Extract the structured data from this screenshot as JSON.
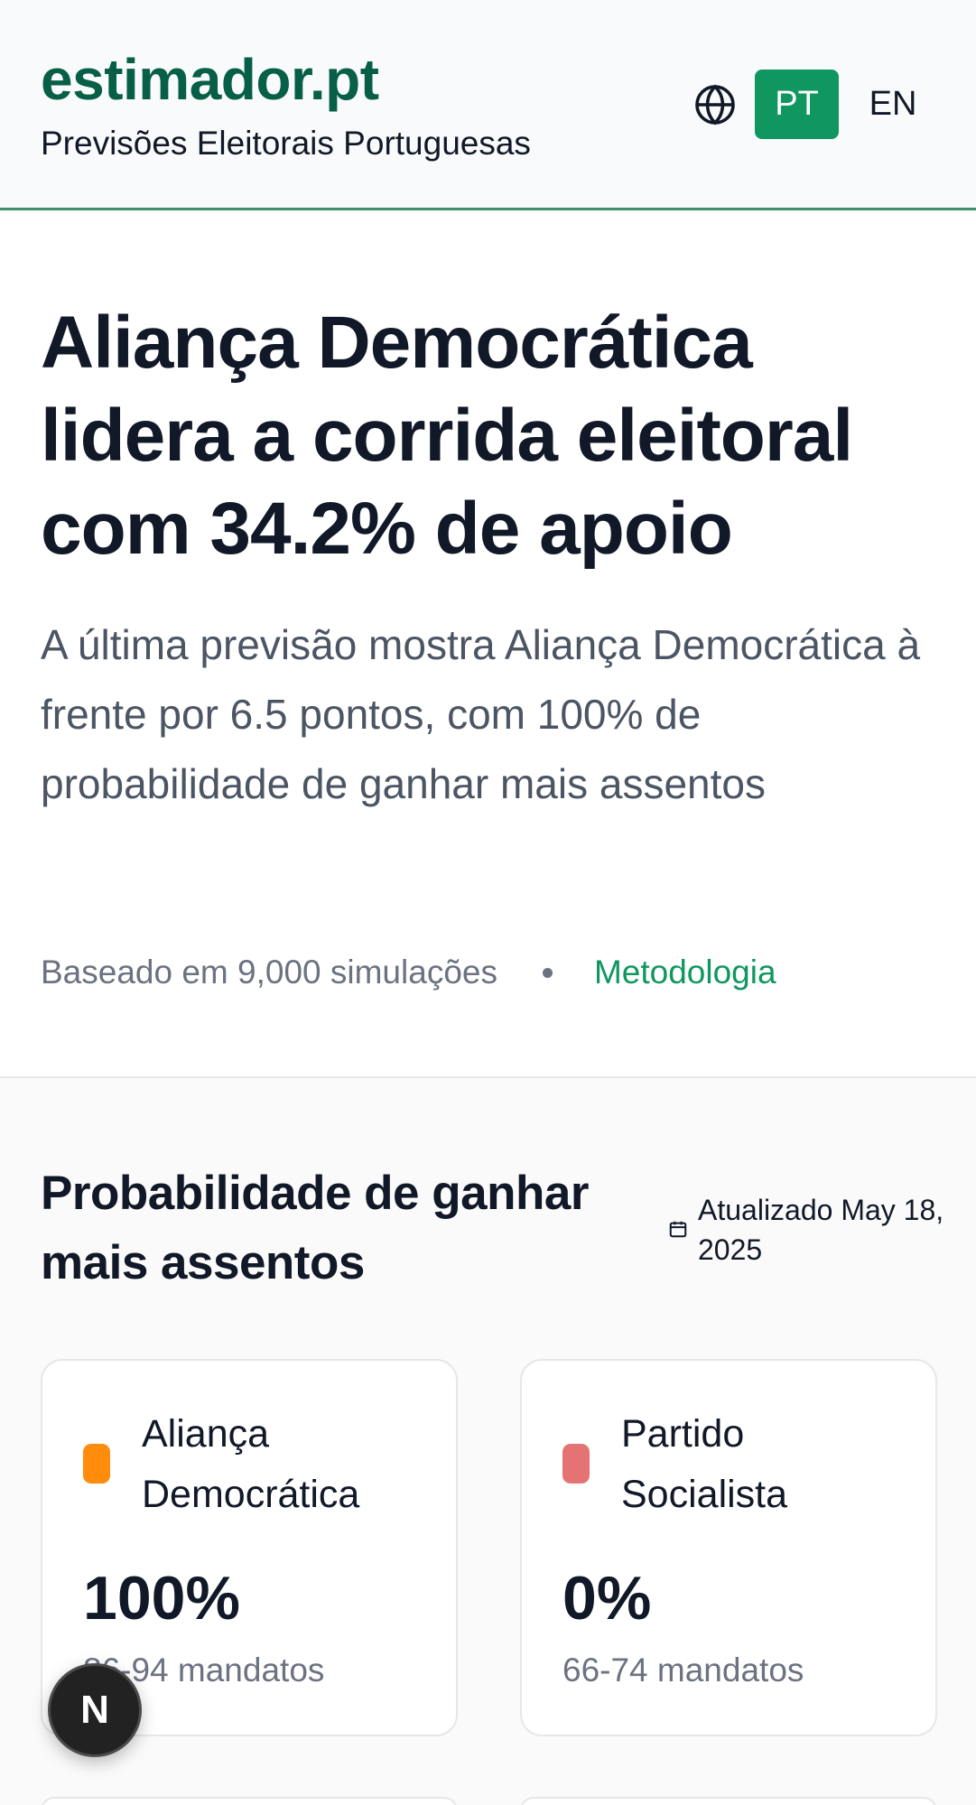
{
  "header": {
    "brand": "estimador.pt",
    "tagline": "Previsões Eleitorais Portuguesas",
    "language_icon": "globe-icon",
    "languages": [
      "PT",
      "EN"
    ],
    "active_language": "PT"
  },
  "hero": {
    "headline": "Aliança Democrática lidera a corrida eleitoral com 34.2% de apoio",
    "lead": "A última previsão mostra Aliança Democrática à frente por 6.5 pontos, com 100% de probabilidade de ganhar mais assentos",
    "simulations": "Baseado em 9,000 simulações",
    "methodology_link": "Metodologia"
  },
  "probability_section": {
    "title": "Probabilidade de ganhar mais assentos",
    "updated_icon": "calendar-icon",
    "updated": "Atualizado May 18, 2025",
    "cards": [
      {
        "party": "Aliança Democrática",
        "color": "#ff8c0a",
        "probability": "100%",
        "seats": "86-94 mandatos"
      },
      {
        "party": "Partido Socialista",
        "color": "#e57373",
        "probability": "0%",
        "seats": "66-74 mandatos"
      }
    ]
  },
  "dev_indicator": {
    "label": "N",
    "icon": "nextjs-icon"
  },
  "colors": {
    "accent": "#10975f",
    "brand": "#065f46"
  }
}
